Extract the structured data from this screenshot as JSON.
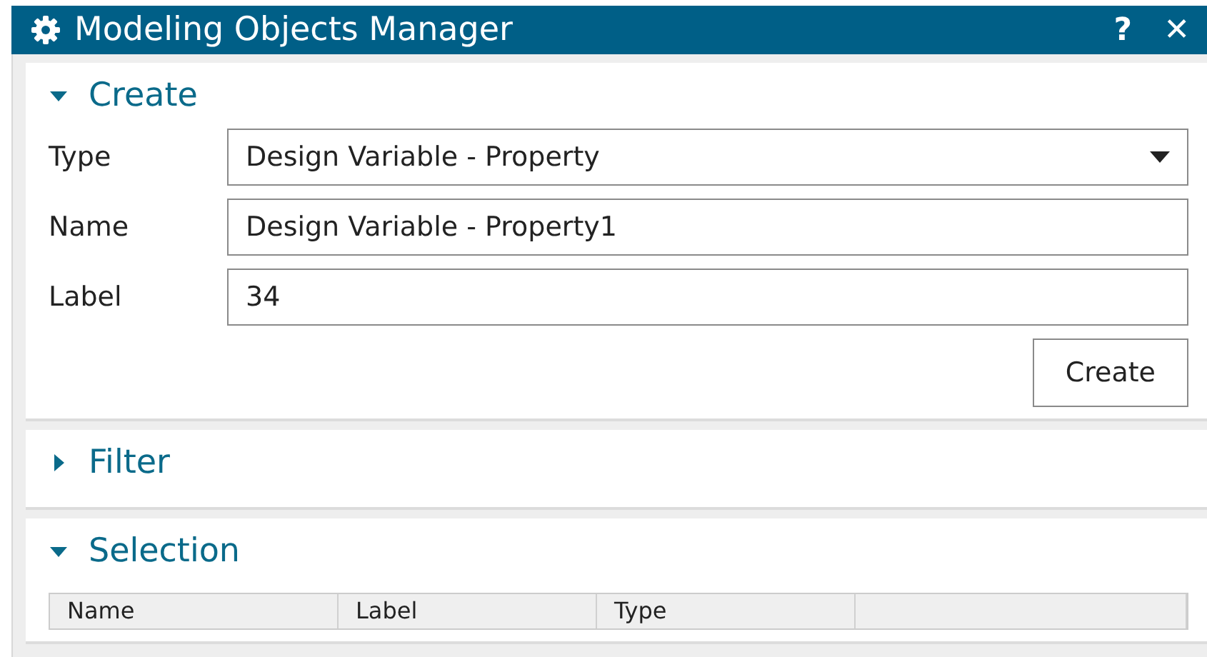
{
  "window": {
    "title": "Modeling Objects Manager",
    "help": "?",
    "close": "✕"
  },
  "sections": [
    {
      "kind": "create",
      "title": "Create",
      "expanded": true,
      "fields": [
        {
          "kind": "select",
          "label": "Type",
          "value": "Design Variable - Property"
        },
        {
          "kind": "text",
          "label": "Name",
          "value": "Design Variable - Property1"
        },
        {
          "kind": "text",
          "label": "Label",
          "value": "34"
        }
      ],
      "button": "Create"
    },
    {
      "title": "Filter",
      "expanded": false
    },
    {
      "kind": "table",
      "title": "Selection",
      "expanded": true,
      "columns": [
        "Name",
        "Label",
        "Type",
        ""
      ]
    }
  ]
}
